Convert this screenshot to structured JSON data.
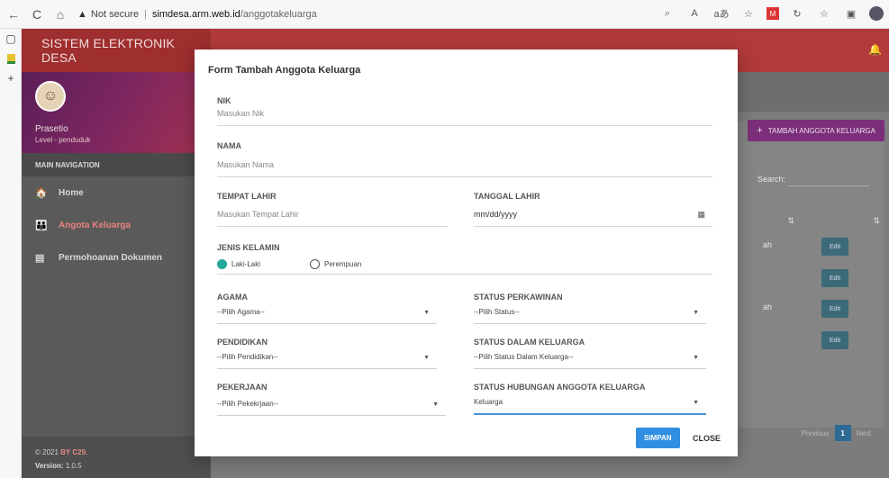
{
  "browser": {
    "back": "←",
    "refresh": "C",
    "home": "⌂",
    "security_label": "Not secure",
    "host": "simdesa.arm.web.id",
    "path": "/anggotakeluarga",
    "icons": [
      "search-icon",
      "read-aloud-icon",
      "translate-icon",
      "favorite-icon",
      "extension-icon",
      "refresh-icon",
      "favorites-icon",
      "collections-icon",
      "profile-icon"
    ]
  },
  "app": {
    "brand": "SISTEM ELEKTRONIK DESA",
    "user_name": "Prasetio",
    "user_level": "Level - penduduk",
    "nav_header": "MAIN NAVIGATION",
    "nav_items": [
      {
        "label": "Home",
        "icon": "home-icon"
      },
      {
        "label": "Angota Keluarga",
        "icon": "family-icon"
      },
      {
        "label": "Permohoanan Dokumen",
        "icon": "document-icon"
      }
    ],
    "footer_copyright": "© 2021",
    "footer_by": "BY C29.",
    "footer_version_label": "Version:",
    "footer_version": "1.0.5",
    "add_button": "TAMBAH ANGGOTA KELUARGA",
    "search_label": "Search:",
    "edit_label": "Edit",
    "row_fragments": [
      "ah",
      "ah"
    ],
    "pager_prev": "Previous",
    "pager_current": "1",
    "pager_next": "Next",
    "sort_glyph": "⇅"
  },
  "modal": {
    "title": "Form Tambah Anggota Keluarga",
    "nik_label": "NIK",
    "nik_placeholder": "Masukan Nik",
    "nama_label": "NAMA",
    "nama_placeholder": "Masukan Nama",
    "tempat_label": "TEMPAT LAHIR",
    "tempat_placeholder": "Masukan Tempat Lahir",
    "tanggal_label": "TANGGAL LAHIR",
    "tanggal_placeholder": "mm/dd/yyyy",
    "jk_label": "JENIS KELAMIN",
    "jk_option1": "Laki-Laki",
    "jk_option2": "Perempuan",
    "agama_label": "AGAMA",
    "agama_value": "--Pilih Agama--",
    "perkawinan_label": "STATUS PERKAWINAN",
    "perkawinan_value": "--Pilih Status--",
    "pendidikan_label": "PENDIDIKAN",
    "pendidikan_value": "--Pilih Pendidikan--",
    "status_keluarga_label": "STATUS DALAM KELUARGA",
    "status_keluarga_value": "--Pilih Status Dalam Keluarga--",
    "pekerjaan_label": "PEKERJAAN",
    "pekerjaan_value": "--Pilih Pekekrjaan--",
    "hubungan_label": "STATUS HUBUNGAN ANGGOTA KELUARGA",
    "hubungan_value": "Keluarga",
    "simpan": "SIMPAN",
    "close": "CLOSE"
  },
  "colors": {
    "topbar": "#b23a3a",
    "accent_teal": "#22a89a",
    "primary_button": "#2f8ee0",
    "add_button": "#7b2f7a"
  }
}
